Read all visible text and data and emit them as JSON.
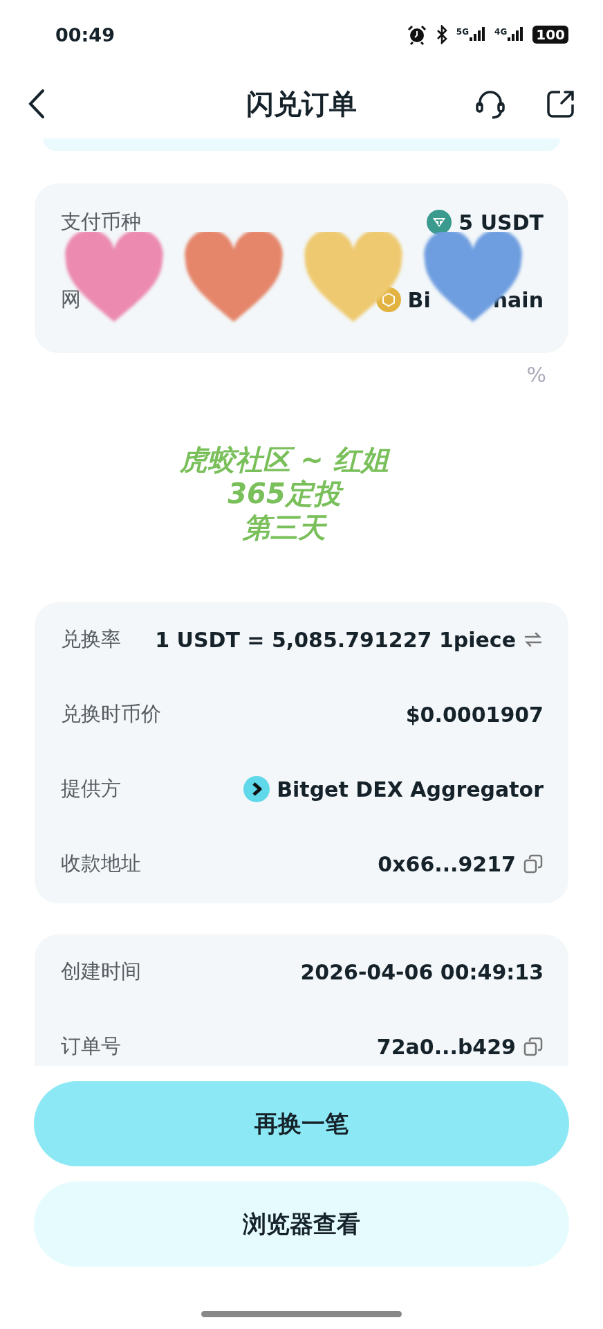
{
  "status_bar": {
    "time": "00:49",
    "network_1": "5G",
    "network_2": "4G",
    "battery": "100"
  },
  "header": {
    "title": "闪兑订单"
  },
  "payment_card": {
    "rows": [
      {
        "kind": "token",
        "label": "支付币种",
        "value": "5 USDT"
      },
      {
        "kind": "covered",
        "label": "网",
        "value": "Bi",
        "value_tail": "hain"
      }
    ]
  },
  "stickers": [
    {
      "color": "#ec8ab0"
    },
    {
      "color": "#e5856a"
    },
    {
      "color": "#eec970"
    },
    {
      "color": "#6e9ee0"
    }
  ],
  "covered_text": "%",
  "caption": [
    "虎蛟社区 ~ 红姐",
    "365定投",
    "第三天"
  ],
  "details_card": {
    "rows": [
      {
        "kind": "swap",
        "label": "兑换率",
        "value": "1 USDT = 5,085.791227 1piece"
      },
      {
        "kind": "plain",
        "label": "兑换时币价",
        "value": "$0.0001907"
      },
      {
        "kind": "provider",
        "label": "提供方",
        "value": "Bitget DEX Aggregator"
      },
      {
        "kind": "copy",
        "label": "收款地址",
        "value": "0x66...9217"
      }
    ]
  },
  "time_card": {
    "rows": [
      {
        "kind": "plain",
        "label": "创建时间",
        "value": "2026-04-06 00:49:13"
      },
      {
        "kind": "copy",
        "label": "订单号",
        "value": "72a0...b429"
      }
    ]
  },
  "buttons": [
    {
      "label": "再换一笔",
      "kind": "primary"
    },
    {
      "label": "浏览器查看",
      "kind": "secondary"
    }
  ]
}
